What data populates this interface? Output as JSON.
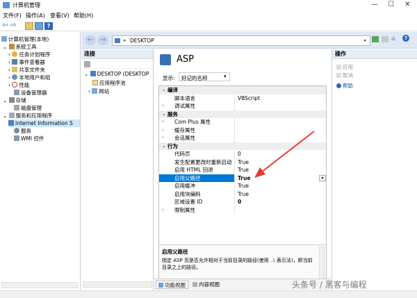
{
  "window": {
    "title": "计算机管理"
  },
  "menu": [
    "文件(F)",
    "操作(A)",
    "查看(V)",
    "帮助(H)"
  ],
  "tree": {
    "root": "计算机管理(本地)",
    "items": [
      {
        "label": "系统工具"
      },
      {
        "label": "任务计划程序"
      },
      {
        "label": "事件查看器"
      },
      {
        "label": "共享文件夹"
      },
      {
        "label": "本地用户和组"
      },
      {
        "label": "性能"
      },
      {
        "label": "设备管理器"
      },
      {
        "label": "存储"
      },
      {
        "label": "磁盘管理"
      },
      {
        "label": "服务和应用程序"
      },
      {
        "label": "Internet Information S"
      },
      {
        "label": "服务"
      },
      {
        "label": "WMI 控件"
      }
    ]
  },
  "address": {
    "path": "DESKTOP"
  },
  "connections": {
    "header": "连接",
    "items": [
      "DESKTOP (DESKTOP",
      "应用程序池",
      "网站"
    ]
  },
  "feature": {
    "title": "ASP",
    "display_label": "显示:",
    "display_value": "好记的名称",
    "categories": [
      {
        "name": "编译",
        "rows": [
          {
            "k": "脚本语言",
            "v": "VBScript"
          },
          {
            "k": "调试属性",
            "v": "",
            "collapsed": true
          }
        ]
      },
      {
        "name": "服务",
        "rows": [
          {
            "k": "Com Plus 属性",
            "v": "",
            "collapsed": true
          },
          {
            "k": "缓存属性",
            "v": "",
            "collapsed": true
          },
          {
            "k": "会话属性",
            "v": "",
            "collapsed": true
          }
        ]
      },
      {
        "name": "行为",
        "rows": [
          {
            "k": "代码页",
            "v": "0"
          },
          {
            "k": "发生配置更改时重新启动",
            "v": "True"
          },
          {
            "k": "启用 HTML 回退",
            "v": "True"
          },
          {
            "k": "启用父路径",
            "v": "True",
            "selected": true
          },
          {
            "k": "启用缓冲",
            "v": "True"
          },
          {
            "k": "启用块编码",
            "v": "True"
          },
          {
            "k": "区域设置 ID",
            "v": "0"
          },
          {
            "k": "限制属性",
            "v": "",
            "collapsed": true
          }
        ]
      }
    ],
    "desc_title": "启用父路径",
    "desc_text": "指定 ASP 页是否允许相对于当前目录的路径(使用 ..\\ 表示法)，即当前目录之上的路径。"
  },
  "tabs": {
    "features": "功能视图",
    "content": "内容视图"
  },
  "actions": {
    "header": "操作",
    "items": [
      {
        "label": "应用",
        "enabled": false
      },
      {
        "label": "取消",
        "enabled": false
      },
      {
        "label": "帮助",
        "enabled": true
      }
    ]
  },
  "watermark": "头条号 / 黑客与编程",
  "colors": {
    "accent": "#0078d7",
    "annotation": "#e53935"
  }
}
